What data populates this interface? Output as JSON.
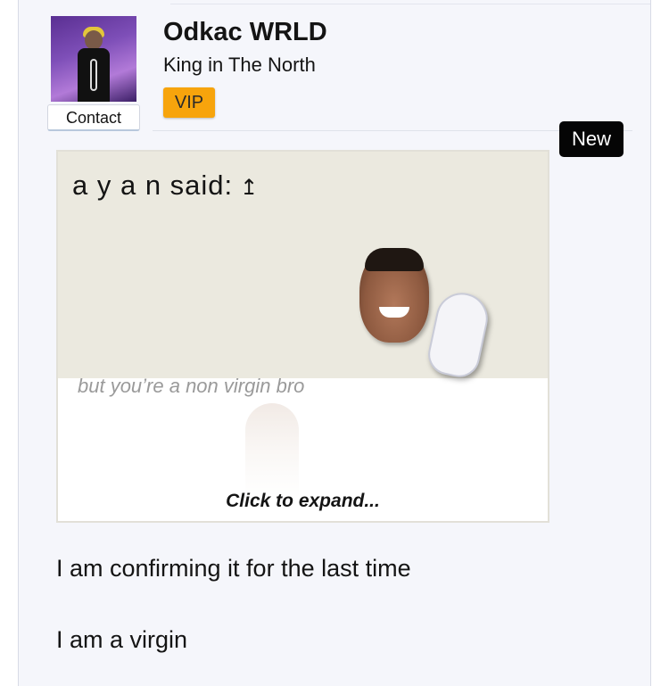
{
  "user": {
    "name": "Odkac WRLD",
    "title": "King in The North",
    "badge": "VIP",
    "contact_label": "Contact"
  },
  "post": {
    "new_badge": "New",
    "quote": {
      "author_said": "a y a n said:",
      "arrow": "↥",
      "text": "but you’re a non virgin bro",
      "expand_label": "Click to expand..."
    },
    "message_lines": [
      "I am confirming it for the last time",
      "I am a virgin"
    ]
  },
  "colors": {
    "vip_badge": "#f7a40c",
    "new_badge": "#050505",
    "quote_header": "#ebe9df",
    "panel": "#f5f6fb"
  }
}
